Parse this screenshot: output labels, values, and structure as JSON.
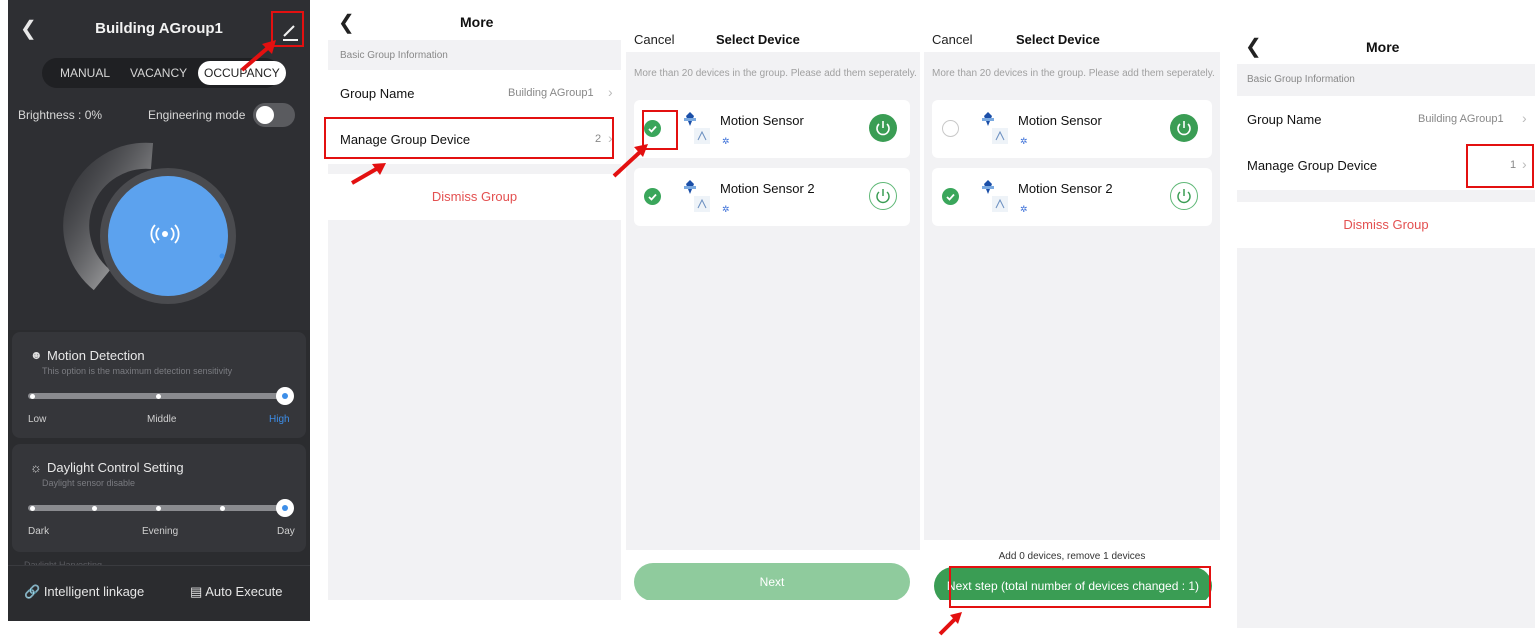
{
  "panel1": {
    "title": "Building AGroup1",
    "modes": [
      "MANUAL",
      "VACANCY",
      "OCCUPANCY"
    ],
    "active_mode": "OCCUPANCY",
    "brightness_label": "Brightness : 0%",
    "engineering_mode_label": "Engineering mode",
    "engineering_mode_on": false,
    "motion": {
      "title": "Motion Detection",
      "subtitle": "This option is the maximum detection sensitivity",
      "labels": [
        "Low",
        "Middle",
        "High"
      ],
      "selected": "High"
    },
    "daylight": {
      "title": "Daylight Control Setting",
      "subtitle": "Daylight sensor disable",
      "labels": [
        "Dark",
        "Evening",
        "Day"
      ],
      "selected": "Day"
    },
    "faded_label": "Daylight Harvesting",
    "bottom_buttons": [
      "Intelligent linkage",
      "Auto Execute"
    ],
    "colors": {
      "accent": "#3d8ee8",
      "background": "#2b2c2f"
    }
  },
  "panel2": {
    "title": "More",
    "section": "Basic Group Information",
    "group_name_label": "Group Name",
    "group_name_value": "Building AGroup1",
    "manage_label": "Manage Group Device",
    "manage_count": "2",
    "dismiss": "Dismiss Group"
  },
  "panel3": {
    "cancel": "Cancel",
    "title": "Select Device",
    "note": "More than 20 devices in the group. Please add them seperately.",
    "devices": [
      {
        "name": "Motion Sensor",
        "checked": true,
        "power": "on"
      },
      {
        "name": "Motion Sensor 2",
        "checked": true,
        "power": "off"
      }
    ],
    "next": "Next"
  },
  "panel4": {
    "cancel": "Cancel",
    "title": "Select Device",
    "note": "More than 20 devices in the group. Please add them seperately.",
    "devices": [
      {
        "name": "Motion Sensor",
        "checked": false,
        "power": "on"
      },
      {
        "name": "Motion Sensor 2",
        "checked": true,
        "power": "off"
      }
    ],
    "summary": "Add 0 devices, remove 1 devices",
    "next": "Next step (total number of devices changed : 1)"
  },
  "panel5": {
    "title": "More",
    "section": "Basic Group Information",
    "group_name_label": "Group Name",
    "group_name_value": "Building AGroup1",
    "manage_label": "Manage Group Device",
    "manage_count": "1",
    "dismiss": "Dismiss Group"
  },
  "colors": {
    "green": "#3a9d54",
    "next_disabled": "#8fcb9d",
    "red_annotation": "#e31010",
    "danger": "#e35050"
  }
}
